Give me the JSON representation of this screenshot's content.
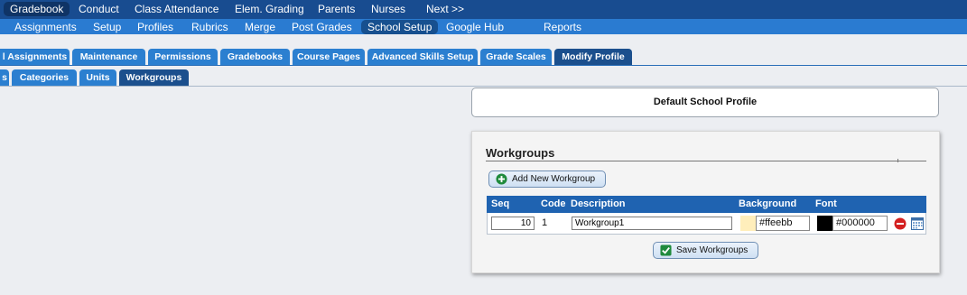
{
  "nav_primary": [
    "Gradebook",
    "Conduct",
    "Class Attendance",
    "Elem. Grading",
    "Parents",
    "Nurses",
    "Next >>"
  ],
  "nav_secondary": [
    "Assignments",
    "Setup",
    "Profiles",
    "Rubrics",
    "Merge",
    "Post Grades",
    "School Setup",
    "Google Hub",
    "Reports"
  ],
  "tabs_row1": [
    "l Assignments",
    "Maintenance",
    "Permissions",
    "Gradebooks",
    "Course Pages",
    "Advanced Skills Setup",
    "Grade Scales",
    "Modify Profile"
  ],
  "tabs_row2": [
    "s",
    "Categories",
    "Units",
    "Workgroups"
  ],
  "profile_name": "Default School Profile",
  "workgroups": {
    "title": "Workgroups",
    "add_button": "Add New Workgroup",
    "save_button": "Save Workgroups",
    "columns": [
      "Seq",
      "Code",
      "Description",
      "Background",
      "Font"
    ],
    "row": {
      "seq": "10",
      "code": "1",
      "description": "Workgroup1",
      "background": "#ffeebb",
      "font": "#000000"
    }
  },
  "colors": {
    "nav_dark": "#184c90",
    "nav_light": "#2a7bd1",
    "tab": "#2b7fd0",
    "tab_active": "#1b4f8d",
    "table_header": "#1f63b1",
    "background_swatch": "#ffeebb",
    "font_swatch": "#000000"
  },
  "icons": {
    "add": "plus-circle-icon",
    "delete": "minus-circle-icon",
    "calendar": "calendar-icon",
    "save": "checkbox-icon"
  }
}
